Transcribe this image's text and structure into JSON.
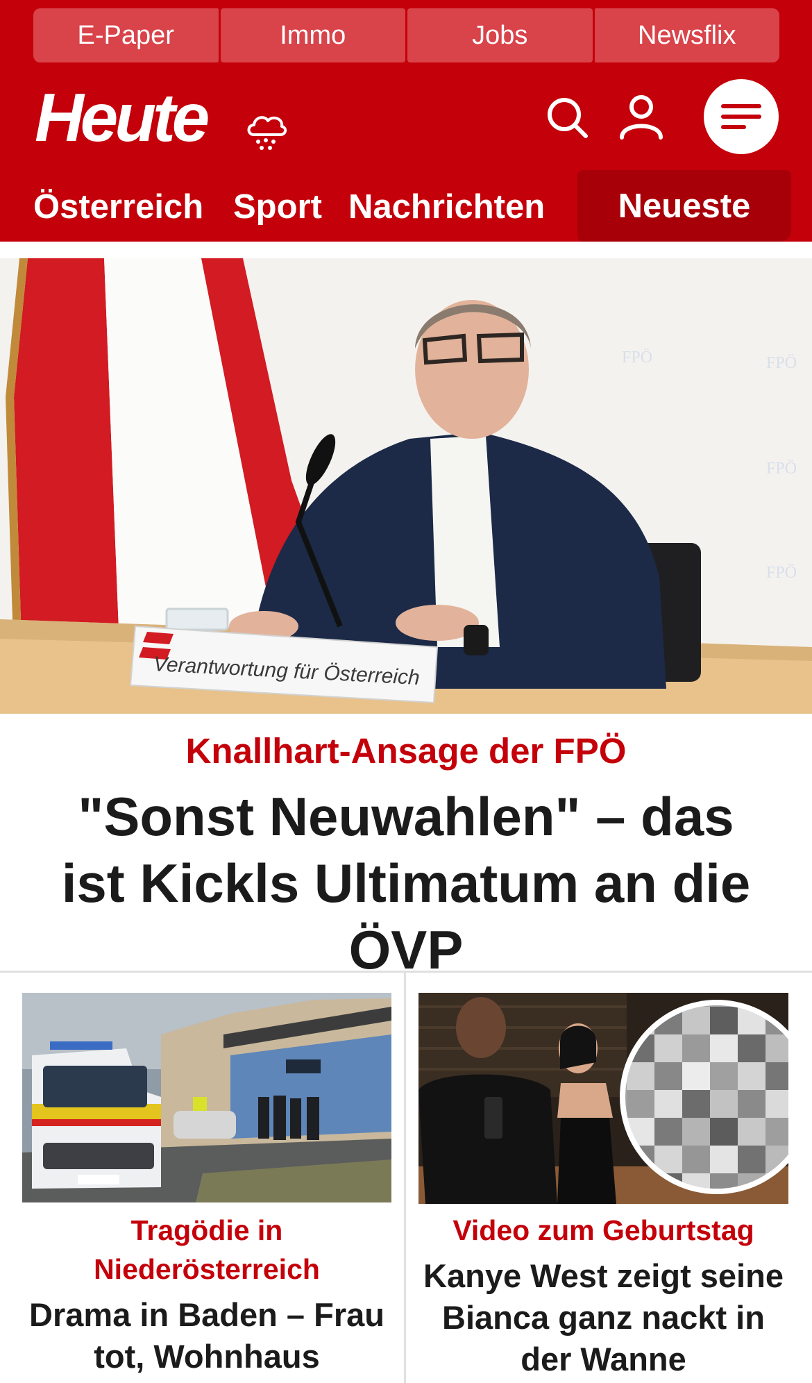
{
  "top_links": [
    "E-Paper",
    "Immo",
    "Jobs",
    "Newsflix"
  ],
  "logo": {
    "text": "Heute"
  },
  "header_icons": [
    "weather-icon",
    "search-icon",
    "user-icon",
    "menu-icon"
  ],
  "nav": {
    "items": [
      "Österreich",
      "Sport",
      "Nachrichten"
    ],
    "active": "Neueste"
  },
  "hero": {
    "image_caption": "Verantwortung für Österreich",
    "kicker": "Knallhart-Ansage der FPÖ",
    "headline": "\"Sonst Neuwahlen\" – das ist Kickls Ultimatum an die ÖVP"
  },
  "cards": [
    {
      "kicker": "Tragödie in Niederösterreich",
      "title": "Drama in Baden – Frau tot, Wohnhaus"
    },
    {
      "kicker": "Video zum Geburtstag",
      "title": "Kanye West zeigt seine Bianca ganz nackt in der Wanne"
    }
  ],
  "colors": {
    "brand_red": "#c4000a",
    "dark_red": "#a80009",
    "link_bg": "#d9434a"
  }
}
